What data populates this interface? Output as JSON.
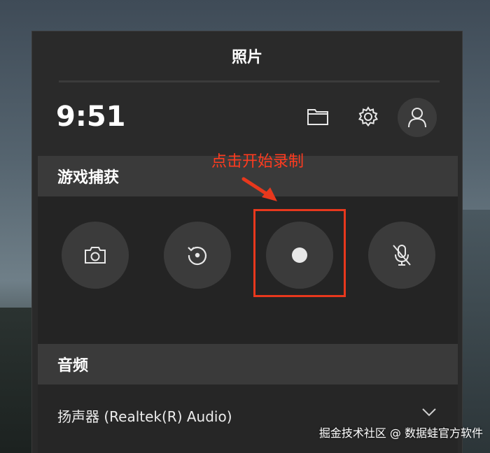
{
  "panel": {
    "title": "照片"
  },
  "header": {
    "time": "9:51"
  },
  "sections": {
    "capture": {
      "title": "游戏捕获",
      "buttons": [
        {
          "icon": "camera-icon"
        },
        {
          "icon": "record-last-icon"
        },
        {
          "icon": "record-dot-icon"
        },
        {
          "icon": "mic-off-icon"
        }
      ]
    },
    "audio": {
      "title": "音频",
      "speaker_label": "扬声器 (Realtek(R) Audio)"
    }
  },
  "annotation": {
    "text": "点击开始录制",
    "color": "#e8381d"
  },
  "watermark": "掘金技术社区 @ 数据蛙官方软件",
  "colors": {
    "panel_bg": "#2a2a2a",
    "section_header_bg": "#3a3a3a",
    "button_bg": "#3b3b3b"
  }
}
